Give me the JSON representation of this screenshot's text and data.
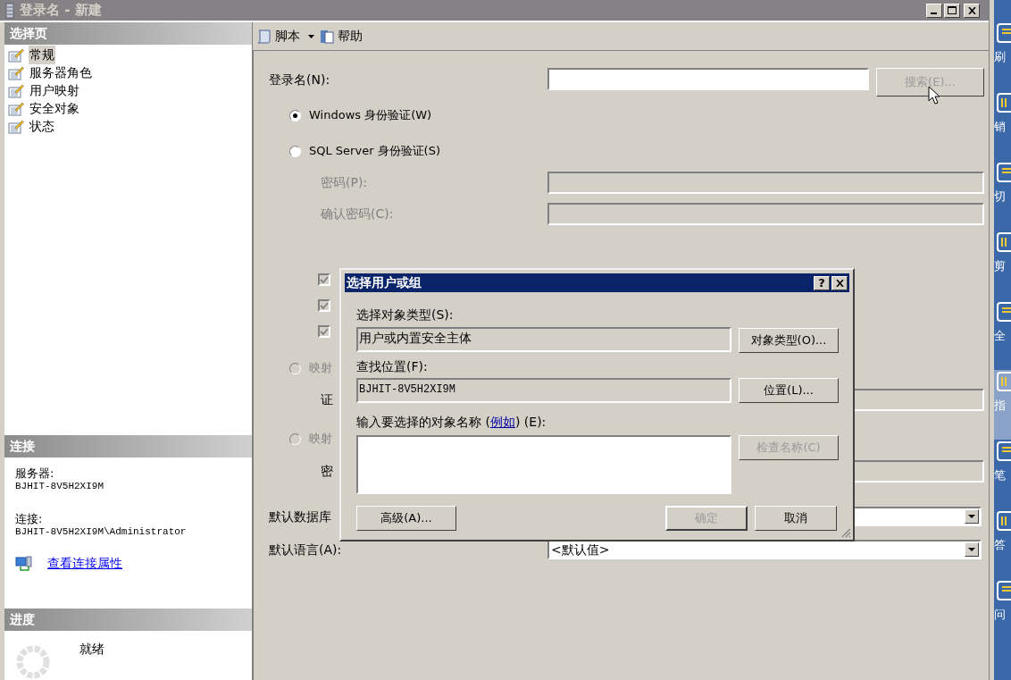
{
  "window": {
    "title": "登录名 - 新建"
  },
  "sidebar": {
    "header": "选择页",
    "items": [
      {
        "label": "常规",
        "selected": true
      },
      {
        "label": "服务器角色",
        "selected": false
      },
      {
        "label": "用户映射",
        "selected": false
      },
      {
        "label": "安全对象",
        "selected": false
      },
      {
        "label": "状态",
        "selected": false
      }
    ]
  },
  "connection": {
    "header": "连接",
    "server_label": "服务器:",
    "server": "BJHIT-8V5H2XI9M",
    "connection_label": "连接:",
    "connection": "BJHIT-8V5H2XI9M\\Administrator",
    "link": "查看连接属性"
  },
  "progress": {
    "header": "进度",
    "status": "就绪"
  },
  "toolbar": [
    {
      "label": "脚本",
      "kind": "dropdown"
    },
    {
      "label": "帮助",
      "kind": "button"
    }
  ],
  "form": {
    "login_label": "登录名(N):",
    "search_button": {
      "label": "搜索(E)...",
      "disabled": true
    },
    "auth": [
      {
        "label": "Windows 身份验证(W)",
        "selected": true,
        "disabled": false
      },
      {
        "label": "SQL Server 身份验证(S)",
        "selected": false,
        "disabled": false
      }
    ],
    "password_fields": [
      {
        "label": "密码(P):",
        "disabled": true
      },
      {
        "label": "确认密码(C):",
        "disabled": true
      }
    ],
    "checkboxes": [
      {
        "checked": true,
        "disabled": true
      },
      {
        "checked": true,
        "disabled": true
      },
      {
        "checked": true,
        "disabled": true
      }
    ],
    "mappings": [
      {
        "label": "映射",
        "selected": false,
        "field_label": "证"
      },
      {
        "label": "映射",
        "selected": false,
        "field_label": "密"
      }
    ],
    "default_db_label": "默认数据库",
    "default_language_label": "默认语言(A):",
    "default_language": "<默认值>"
  },
  "dialog": {
    "title": "选择用户或组",
    "help": "?",
    "object_type_label": "选择对象类型(S):",
    "object_type": "用户或内置安全主体",
    "object_type_button": "对象类型(O)...",
    "location_label": "查找位置(F):",
    "location": "BJHIT-8V5H2XI9M",
    "location_button": "位置(L)...",
    "names_label_before": "输入要选择的对象名称 (",
    "names_link": "例如",
    "names_label_after": ") (E):",
    "check_names_button": {
      "label": "检查名称(C)",
      "disabled": true
    },
    "advanced_button": "高级(A)...",
    "ok_button": {
      "label": "确定",
      "disabled": true
    },
    "cancel_button": "取消"
  },
  "side_strip": [
    {
      "label": "刷",
      "selected": false
    },
    {
      "label": "销",
      "selected": false
    },
    {
      "label": "切",
      "selected": false
    },
    {
      "label": "剪",
      "selected": false
    },
    {
      "label": "全",
      "selected": false
    },
    {
      "label": "指",
      "selected": true
    },
    {
      "label": "笔",
      "selected": false
    },
    {
      "label": "答",
      "selected": false
    },
    {
      "label": "问",
      "selected": false
    }
  ]
}
